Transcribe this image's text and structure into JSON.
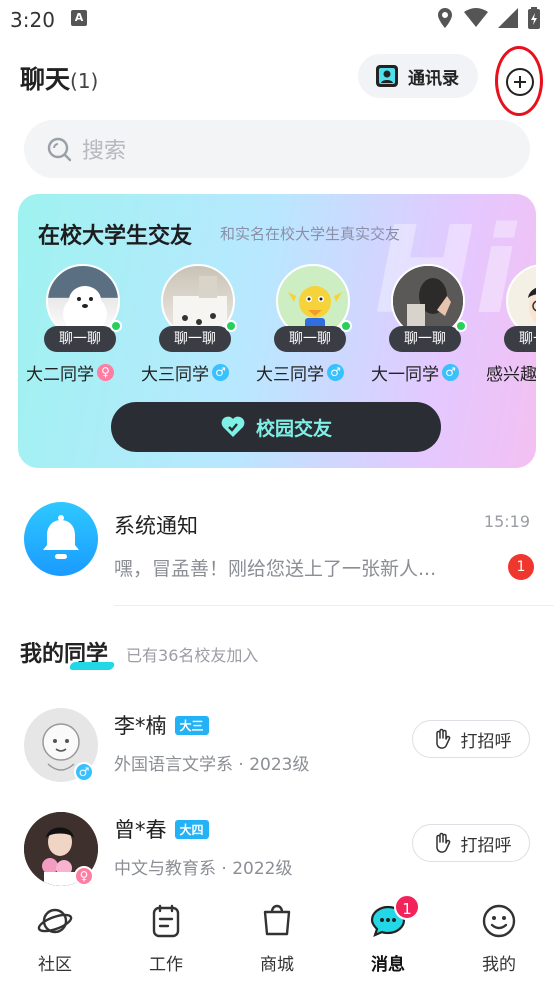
{
  "status": {
    "time": "3:20",
    "notif_letter": "A"
  },
  "header": {
    "title": "聊天",
    "count": "(1)",
    "contacts_label": "通讯录"
  },
  "search": {
    "placeholder": "搜索"
  },
  "banner": {
    "title": "在校大学生交友",
    "subtitle": "和实名在校大学生真实交友",
    "chat_label": "聊一聊",
    "button_label": "校园交友",
    "people": [
      {
        "name": "大二同学",
        "gender": "female"
      },
      {
        "name": "大三同学",
        "gender": "male"
      },
      {
        "name": "大三同学",
        "gender": "male"
      },
      {
        "name": "大一同学",
        "gender": "male"
      },
      {
        "name": "感兴趣",
        "gender": "none"
      }
    ]
  },
  "notification": {
    "title": "系统通知",
    "time": "15:19",
    "message": "嘿，冒孟善！刚给您送上了一张新人...",
    "badge": "1"
  },
  "classmates": {
    "title": "我的同学",
    "subtitle": "已有36名校友加入",
    "greet_label": "打招呼",
    "items": [
      {
        "name": "李*楠",
        "grade": "大三",
        "meta": "外国语言文学系 · 2023级",
        "gender": "male"
      },
      {
        "name": "曾*春",
        "grade": "大四",
        "meta": "中文与教育系 · 2022级",
        "gender": "female"
      }
    ]
  },
  "tabs": [
    {
      "label": "社区",
      "icon": "planet-icon"
    },
    {
      "label": "工作",
      "icon": "clipboard-icon"
    },
    {
      "label": "商城",
      "icon": "shopping-bag-icon"
    },
    {
      "label": "消息",
      "icon": "chat-bubble-icon",
      "badge": "1",
      "active": true
    },
    {
      "label": "我的",
      "icon": "smiley-icon"
    }
  ],
  "colors": {
    "accent": "#23d8e6",
    "badge_red": "#f0372e",
    "highlight_ring": "#e8101c"
  }
}
